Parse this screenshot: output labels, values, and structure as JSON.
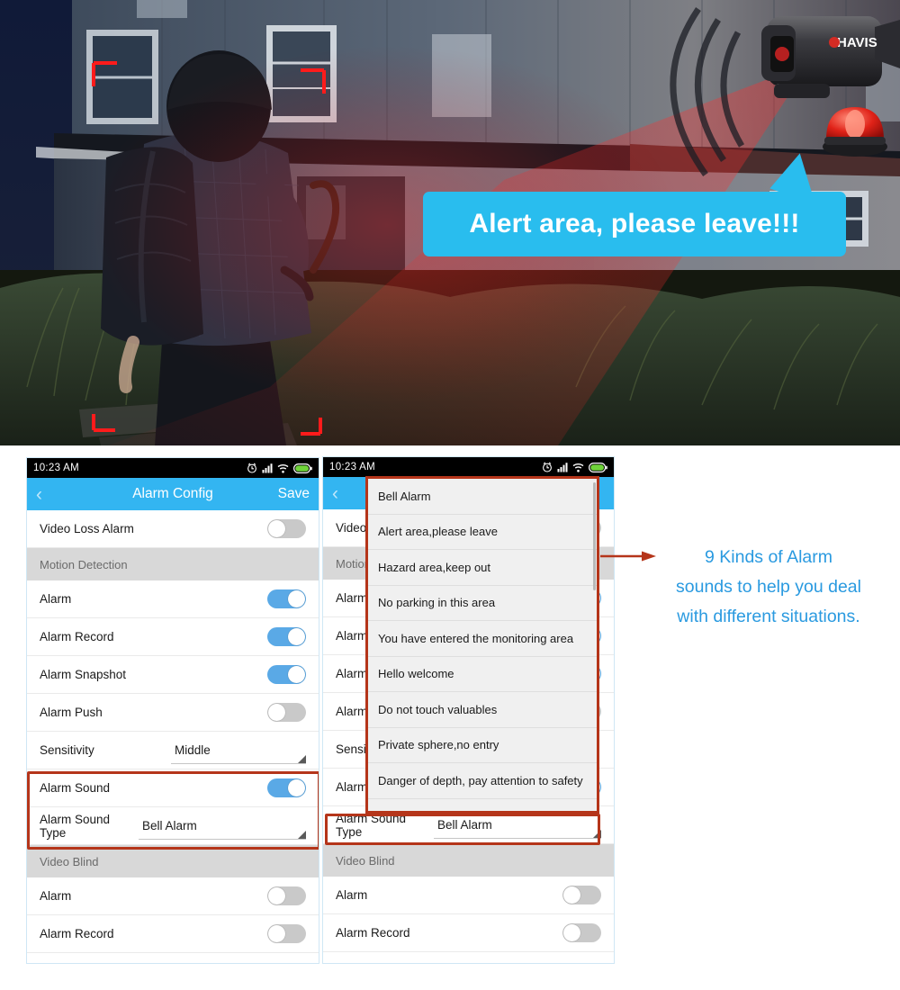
{
  "hero": {
    "scene_description": "night-surveillance-photo-burglar-at-house",
    "bubble_text": "Alert area, please leave!!!",
    "bubble_color": "#29bdee",
    "camera_brand": "HAVIS",
    "focus_brackets": 4
  },
  "phone_left": {
    "statusbar": {
      "time": "10:23 AM",
      "icons": [
        "alarm-clock-icon",
        "signal-bars-icon",
        "wifi-icon",
        "battery-icon"
      ]
    },
    "navbar": {
      "back_glyph": "‹",
      "title": "Alarm Config",
      "save_label": "Save"
    },
    "rows": [
      {
        "type": "toggle",
        "label": "Video Loss Alarm",
        "state": "off"
      },
      {
        "type": "section",
        "label": "Motion Detection"
      },
      {
        "type": "toggle",
        "label": "Alarm",
        "state": "on"
      },
      {
        "type": "toggle",
        "label": "Alarm Record",
        "state": "on"
      },
      {
        "type": "toggle",
        "label": "Alarm Snapshot",
        "state": "on"
      },
      {
        "type": "toggle",
        "label": "Alarm Push",
        "state": "off"
      },
      {
        "type": "select",
        "label": "Sensitivity",
        "value": "Middle"
      },
      {
        "type": "toggle",
        "label": "Alarm Sound",
        "state": "on",
        "highlighted": true
      },
      {
        "type": "select",
        "label": "Alarm Sound Type",
        "value": "Bell Alarm",
        "highlighted": true
      },
      {
        "type": "section",
        "label": "Video Blind"
      },
      {
        "type": "toggle",
        "label": "Alarm",
        "state": "off"
      },
      {
        "type": "toggle",
        "label": "Alarm Record",
        "state": "off"
      }
    ]
  },
  "phone_right": {
    "statusbar": {
      "time": "10:23 AM",
      "icons": [
        "alarm-clock-icon",
        "signal-bars-icon",
        "wifi-icon",
        "battery-icon"
      ]
    },
    "navbar": {
      "back_glyph": "‹",
      "title": "",
      "save_label": ""
    },
    "rows": [
      {
        "type": "toggle",
        "label": "Video",
        "state": "off"
      },
      {
        "type": "section",
        "label": "Motion"
      },
      {
        "type": "toggle",
        "label": "Alarm",
        "state": "on"
      },
      {
        "type": "toggle",
        "label": "Alarm",
        "state": "on"
      },
      {
        "type": "toggle",
        "label": "Alarm",
        "state": "on"
      },
      {
        "type": "toggle",
        "label": "Alarm",
        "state": "off"
      },
      {
        "type": "select",
        "label": "Sensit",
        "value": ""
      },
      {
        "type": "toggle",
        "label": "Alarm",
        "state": "on"
      },
      {
        "type": "select",
        "label": "Alarm Sound Type",
        "value": "Bell Alarm",
        "highlighted": true
      },
      {
        "type": "section",
        "label": "Video Blind"
      },
      {
        "type": "toggle",
        "label": "Alarm",
        "state": "off"
      },
      {
        "type": "toggle",
        "label": "Alarm Record",
        "state": "off"
      }
    ],
    "dropdown": {
      "options": [
        "Bell Alarm",
        "Alert area,please leave",
        "Hazard area,keep out",
        "No parking in this area",
        "You have entered the monitoring area",
        "Hello welcome",
        "Do not touch valuables",
        "Private sphere,no entry",
        "Danger of depth, pay attention to safety"
      ]
    }
  },
  "annotation": {
    "arrow_color": "#b5351a",
    "text_color": "#2a9ae0",
    "lines": [
      "9 Kinds of Alarm",
      "sounds to help you deal",
      "with different situations."
    ]
  },
  "colors": {
    "accent_blue": "#33b5f1",
    "toggle_on": "#5aa9e6",
    "toggle_off": "#c9c9c9",
    "highlight_red": "#b5351a",
    "section_gray": "#d8d8d8"
  }
}
